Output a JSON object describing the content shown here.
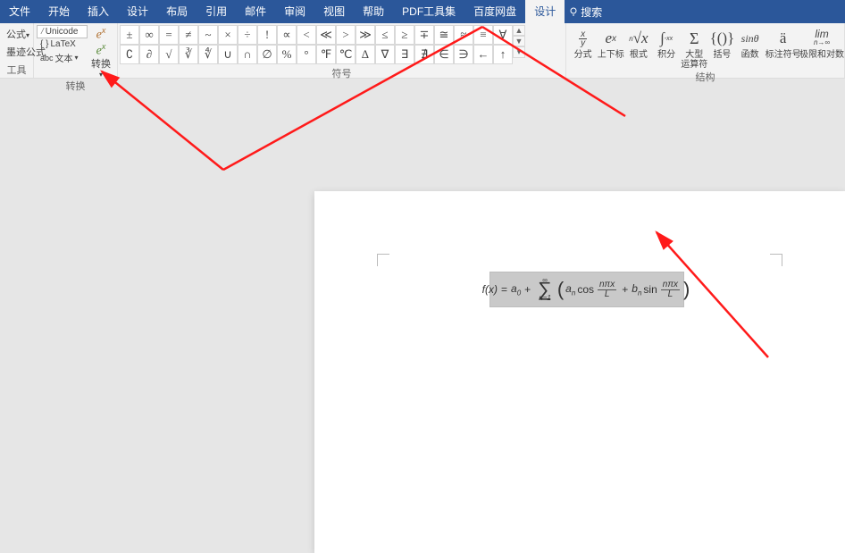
{
  "menu": {
    "tabs": [
      "文件",
      "开始",
      "插入",
      "设计",
      "布局",
      "引用",
      "邮件",
      "审阅",
      "视图",
      "帮助",
      "PDF工具集",
      "百度网盘",
      "设计"
    ],
    "active_index": 12,
    "search_placeholder": "搜索"
  },
  "ribbon": {
    "tools": {
      "formula_label": "公式",
      "ink_label": "墨迹公式",
      "text_label": "文本",
      "group_label": "工具"
    },
    "format": {
      "unicode": "Unicode",
      "latex": "LaTeX",
      "convert": "转换"
    },
    "symbols": {
      "row1": [
        "±",
        "∞",
        "=",
        "≠",
        "~",
        "×",
        "÷",
        "!",
        "∝",
        "<",
        "≪",
        ">",
        "≫",
        "≤",
        "≥",
        "∓",
        "≅",
        "≈",
        "≡",
        "∀"
      ],
      "row2": [
        "∁",
        "∂",
        "√",
        "∛",
        "∜",
        "∪",
        "∩",
        "∅",
        "%",
        "°",
        "℉",
        "℃",
        "∆",
        "∇",
        "∃",
        "∄",
        "∈",
        "∋",
        "←",
        "↑"
      ],
      "group_label": "符号"
    },
    "structures": {
      "items": [
        {
          "glyph": "x/y",
          "label": "分式"
        },
        {
          "glyph": "eˣ",
          "label": "上下标"
        },
        {
          "glyph": "ⁿ√x",
          "label": "根式"
        },
        {
          "glyph": "∫₋ₓˣ",
          "label": "积分"
        },
        {
          "glyph": "Σ",
          "label": "大型\n运算符"
        },
        {
          "glyph": "{()}",
          "label": "括号"
        },
        {
          "glyph": "sinθ",
          "label": "函数"
        },
        {
          "glyph": "ä",
          "label": "标注符号"
        },
        {
          "glyph": "lim",
          "label": "极限和对数"
        }
      ],
      "group_label": "结构"
    }
  },
  "equation": {
    "text": "f(x) = a₀ + Σₙ₌₁^∞ (aₙ cos nπx/L + bₙ sin nπx/L)",
    "a0": "a",
    "zero": "0",
    "an": "a",
    "bn": "b",
    "n": "n",
    "inf": "∞",
    "n1": "n=1",
    "cos": "cos",
    "sin": "sin",
    "npx": "nπx",
    "L": "L",
    "fx": "f(x)",
    "eq": "=",
    "plus": "+"
  },
  "annotations": {
    "arrows": [
      {
        "from": "design-tab",
        "to": "ribbon-convert"
      },
      {
        "from": "equation-box",
        "to": "bottom-right"
      }
    ]
  }
}
